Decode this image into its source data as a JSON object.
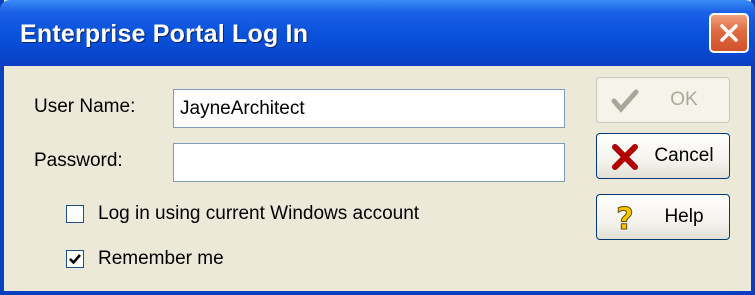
{
  "window": {
    "title": "Enterprise Portal Log In"
  },
  "form": {
    "username_label": "User Name:",
    "username_value": "JayneArchitect",
    "password_label": "Password:",
    "password_value": "",
    "windows_account_label": "Log in using current Windows account",
    "windows_account_checked": false,
    "remember_me_label": "Remember me",
    "remember_me_checked": true
  },
  "buttons": {
    "ok_label": "OK",
    "cancel_label": "Cancel",
    "help_label": "Help"
  },
  "colors": {
    "title_bar": "#0a52dc",
    "dialog_bg": "#ece9d8",
    "close_button": "#e06a40"
  }
}
